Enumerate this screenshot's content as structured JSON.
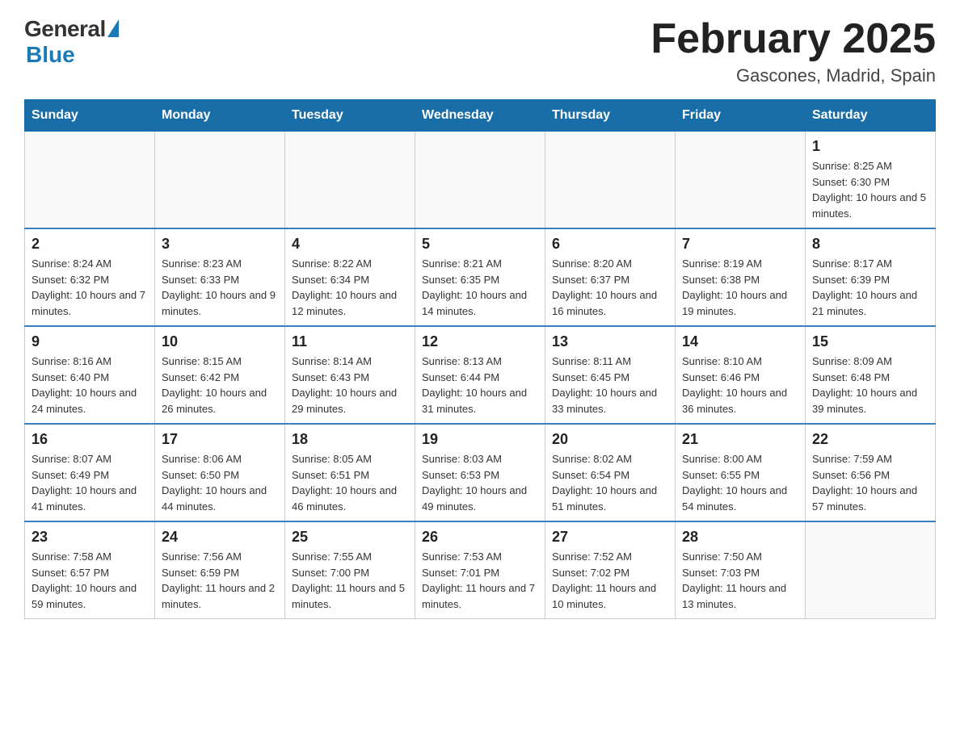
{
  "header": {
    "logo": {
      "general": "General",
      "blue": "Blue"
    },
    "title": "February 2025",
    "location": "Gascones, Madrid, Spain"
  },
  "days_of_week": [
    "Sunday",
    "Monday",
    "Tuesday",
    "Wednesday",
    "Thursday",
    "Friday",
    "Saturday"
  ],
  "weeks": [
    [
      {
        "day": "",
        "info": ""
      },
      {
        "day": "",
        "info": ""
      },
      {
        "day": "",
        "info": ""
      },
      {
        "day": "",
        "info": ""
      },
      {
        "day": "",
        "info": ""
      },
      {
        "day": "",
        "info": ""
      },
      {
        "day": "1",
        "info": "Sunrise: 8:25 AM\nSunset: 6:30 PM\nDaylight: 10 hours and 5 minutes."
      }
    ],
    [
      {
        "day": "2",
        "info": "Sunrise: 8:24 AM\nSunset: 6:32 PM\nDaylight: 10 hours and 7 minutes."
      },
      {
        "day": "3",
        "info": "Sunrise: 8:23 AM\nSunset: 6:33 PM\nDaylight: 10 hours and 9 minutes."
      },
      {
        "day": "4",
        "info": "Sunrise: 8:22 AM\nSunset: 6:34 PM\nDaylight: 10 hours and 12 minutes."
      },
      {
        "day": "5",
        "info": "Sunrise: 8:21 AM\nSunset: 6:35 PM\nDaylight: 10 hours and 14 minutes."
      },
      {
        "day": "6",
        "info": "Sunrise: 8:20 AM\nSunset: 6:37 PM\nDaylight: 10 hours and 16 minutes."
      },
      {
        "day": "7",
        "info": "Sunrise: 8:19 AM\nSunset: 6:38 PM\nDaylight: 10 hours and 19 minutes."
      },
      {
        "day": "8",
        "info": "Sunrise: 8:17 AM\nSunset: 6:39 PM\nDaylight: 10 hours and 21 minutes."
      }
    ],
    [
      {
        "day": "9",
        "info": "Sunrise: 8:16 AM\nSunset: 6:40 PM\nDaylight: 10 hours and 24 minutes."
      },
      {
        "day": "10",
        "info": "Sunrise: 8:15 AM\nSunset: 6:42 PM\nDaylight: 10 hours and 26 minutes."
      },
      {
        "day": "11",
        "info": "Sunrise: 8:14 AM\nSunset: 6:43 PM\nDaylight: 10 hours and 29 minutes."
      },
      {
        "day": "12",
        "info": "Sunrise: 8:13 AM\nSunset: 6:44 PM\nDaylight: 10 hours and 31 minutes."
      },
      {
        "day": "13",
        "info": "Sunrise: 8:11 AM\nSunset: 6:45 PM\nDaylight: 10 hours and 33 minutes."
      },
      {
        "day": "14",
        "info": "Sunrise: 8:10 AM\nSunset: 6:46 PM\nDaylight: 10 hours and 36 minutes."
      },
      {
        "day": "15",
        "info": "Sunrise: 8:09 AM\nSunset: 6:48 PM\nDaylight: 10 hours and 39 minutes."
      }
    ],
    [
      {
        "day": "16",
        "info": "Sunrise: 8:07 AM\nSunset: 6:49 PM\nDaylight: 10 hours and 41 minutes."
      },
      {
        "day": "17",
        "info": "Sunrise: 8:06 AM\nSunset: 6:50 PM\nDaylight: 10 hours and 44 minutes."
      },
      {
        "day": "18",
        "info": "Sunrise: 8:05 AM\nSunset: 6:51 PM\nDaylight: 10 hours and 46 minutes."
      },
      {
        "day": "19",
        "info": "Sunrise: 8:03 AM\nSunset: 6:53 PM\nDaylight: 10 hours and 49 minutes."
      },
      {
        "day": "20",
        "info": "Sunrise: 8:02 AM\nSunset: 6:54 PM\nDaylight: 10 hours and 51 minutes."
      },
      {
        "day": "21",
        "info": "Sunrise: 8:00 AM\nSunset: 6:55 PM\nDaylight: 10 hours and 54 minutes."
      },
      {
        "day": "22",
        "info": "Sunrise: 7:59 AM\nSunset: 6:56 PM\nDaylight: 10 hours and 57 minutes."
      }
    ],
    [
      {
        "day": "23",
        "info": "Sunrise: 7:58 AM\nSunset: 6:57 PM\nDaylight: 10 hours and 59 minutes."
      },
      {
        "day": "24",
        "info": "Sunrise: 7:56 AM\nSunset: 6:59 PM\nDaylight: 11 hours and 2 minutes."
      },
      {
        "day": "25",
        "info": "Sunrise: 7:55 AM\nSunset: 7:00 PM\nDaylight: 11 hours and 5 minutes."
      },
      {
        "day": "26",
        "info": "Sunrise: 7:53 AM\nSunset: 7:01 PM\nDaylight: 11 hours and 7 minutes."
      },
      {
        "day": "27",
        "info": "Sunrise: 7:52 AM\nSunset: 7:02 PM\nDaylight: 11 hours and 10 minutes."
      },
      {
        "day": "28",
        "info": "Sunrise: 7:50 AM\nSunset: 7:03 PM\nDaylight: 11 hours and 13 minutes."
      },
      {
        "day": "",
        "info": ""
      }
    ]
  ]
}
